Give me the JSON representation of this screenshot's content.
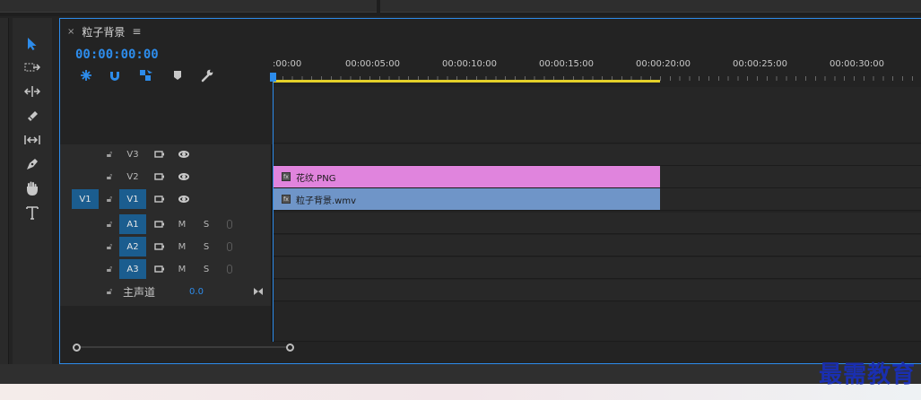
{
  "timeline": {
    "title": "粒子背景",
    "timecode": "00:00:00:00",
    "ruler_labels": [
      ":00:00",
      "00:00:05:00",
      "00:00:10:00",
      "00:00:15:00",
      "00:00:20:00",
      "00:00:25:00",
      "00:00:30:00"
    ]
  },
  "tracks": {
    "video": [
      {
        "name": "V3",
        "source": ""
      },
      {
        "name": "V2",
        "source": ""
      },
      {
        "name": "V1",
        "source": "V1"
      }
    ],
    "audio": [
      {
        "name": "A1",
        "m": "M",
        "s": "S"
      },
      {
        "name": "A2",
        "m": "M",
        "s": "S"
      },
      {
        "name": "A3",
        "m": "M",
        "s": "S"
      }
    ],
    "master": {
      "label": "主声道",
      "value": "0.0"
    }
  },
  "clips": {
    "v2": {
      "label": "花纹.PNG",
      "color": "#e084dd"
    },
    "v1": {
      "label": "粒子背景.wmv",
      "color": "#6f95c8"
    }
  },
  "watermark": "最需教育",
  "colors": {
    "accent": "#2d8ceb",
    "work_area": "#e4d02a"
  }
}
